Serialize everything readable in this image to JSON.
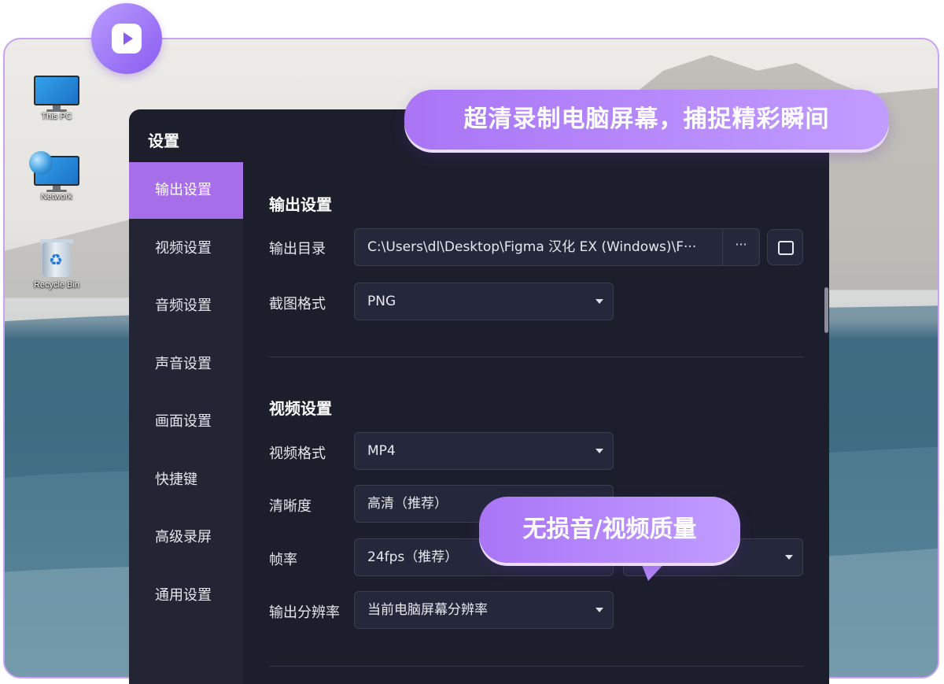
{
  "desktop": {
    "icons": [
      {
        "label": "This PC"
      },
      {
        "label": "Network"
      },
      {
        "label": "Recycle Bin"
      }
    ]
  },
  "window": {
    "title": "设置",
    "sidebar": {
      "items": [
        {
          "label": "输出设置",
          "active": true
        },
        {
          "label": "视频设置"
        },
        {
          "label": "音频设置"
        },
        {
          "label": "声音设置"
        },
        {
          "label": "画面设置"
        },
        {
          "label": "快捷键"
        },
        {
          "label": "高级录屏"
        },
        {
          "label": "通用设置"
        }
      ]
    },
    "output_section": {
      "title": "输出设置",
      "output_dir_label": "输出目录",
      "output_dir_value": "C:\\Users\\dl\\Desktop\\Figma 汉化 EX (Windows)\\F···",
      "more_label": "···",
      "screenshot_format_label": "截图格式",
      "screenshot_format_value": "PNG"
    },
    "video_section": {
      "title": "视频设置",
      "video_format_label": "视频格式",
      "video_format_value": "MP4",
      "clarity_label": "清晰度",
      "clarity_value": "高清（推荐）",
      "framerate_label": "帧率",
      "framerate_value": "24fps（推荐）",
      "resolution_label": "输出分辨率",
      "resolution_value": "当前电脑屏幕分辨率"
    }
  },
  "callouts": {
    "headline": "超清录制电脑屏幕，捕捉精彩瞬间",
    "quality": "无损音/视频质量"
  },
  "colors": {
    "accent": "#a66ee8",
    "window_bg": "#1d1e2c",
    "sidebar_bg": "#232535",
    "frame_border": "#c9a2f5"
  }
}
